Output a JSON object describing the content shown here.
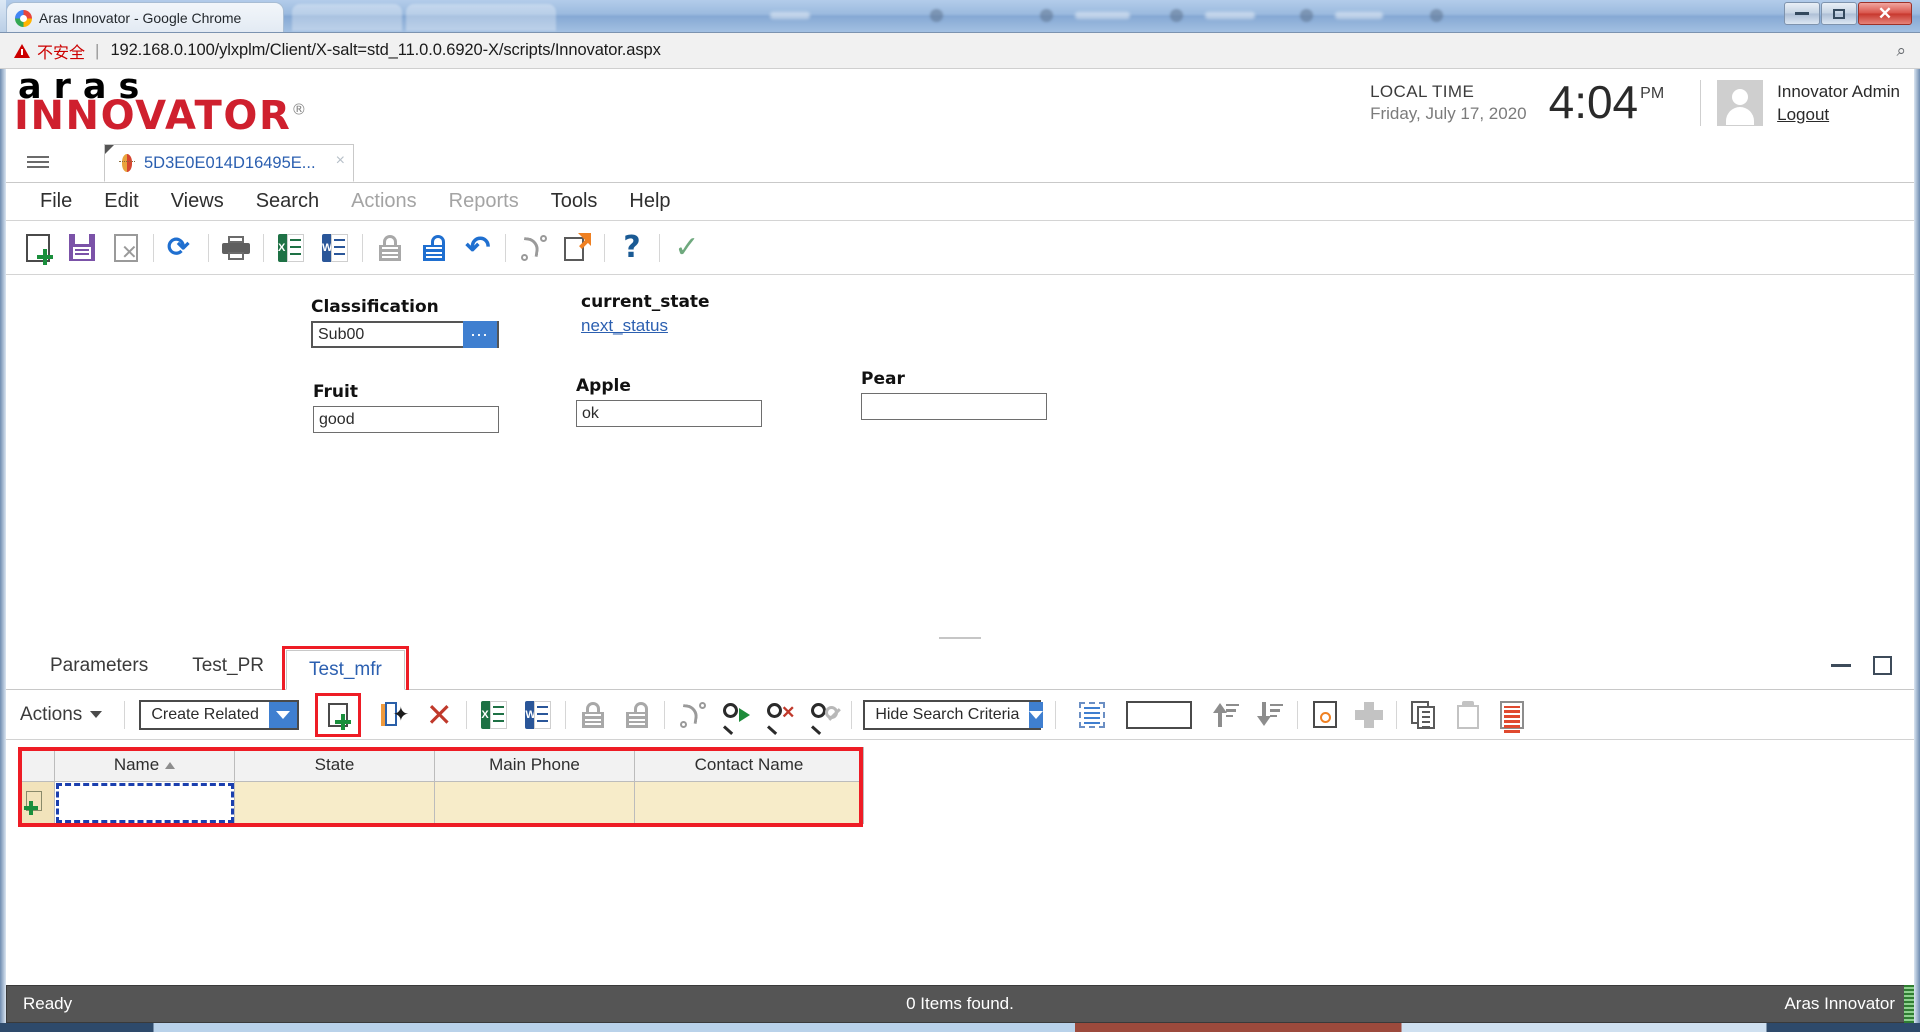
{
  "browser": {
    "tab_title": "Aras Innovator - Google Chrome",
    "favicon": "chrome-icon",
    "insecure_label": "不安全",
    "url_separator": "|",
    "url": "192.168.0.100/ylxplm/Client/X-salt=std_11.0.0.6920-X/scripts/Innovator.aspx",
    "zoom_icon": "magnifier-icon",
    "window_buttons": [
      "minimize",
      "maximize",
      "close"
    ]
  },
  "header": {
    "logo_top": "aras",
    "logo_bottom": "INNOVATOR",
    "logo_reg": "®",
    "local_time_label": "LOCAL TIME",
    "local_date": "Friday, July 17, 2020",
    "time": "4:04",
    "ampm": "PM",
    "avatar_icon": "user-avatar-icon",
    "user_name": "Innovator Admin",
    "logout_label": "Logout"
  },
  "tabstrip": {
    "menu_icon": "hamburger-icon",
    "item_tab_label": "5D3E0E014D16495E...",
    "item_tab_icon": "item-type-icon",
    "close_icon": "close-icon"
  },
  "menubar": {
    "items": [
      {
        "label": "File",
        "disabled": false
      },
      {
        "label": "Edit",
        "disabled": false
      },
      {
        "label": "Views",
        "disabled": false
      },
      {
        "label": "Search",
        "disabled": false
      },
      {
        "label": "Actions",
        "disabled": true
      },
      {
        "label": "Reports",
        "disabled": true
      },
      {
        "label": "Tools",
        "disabled": false
      },
      {
        "label": "Help",
        "disabled": false
      }
    ]
  },
  "toolbar": {
    "buttons": [
      {
        "name": "new-item-button",
        "icon": "new-page-icon"
      },
      {
        "name": "save-button",
        "icon": "save-floppy-icon"
      },
      {
        "name": "delete-button",
        "icon": "delete-page-icon"
      },
      {
        "name": "refresh-button",
        "icon": "refresh-icon"
      },
      {
        "name": "print-button",
        "icon": "print-icon"
      },
      {
        "name": "export-excel-button",
        "icon": "excel-icon"
      },
      {
        "name": "export-word-button",
        "icon": "word-icon"
      },
      {
        "name": "lock-button",
        "icon": "lock-icon"
      },
      {
        "name": "unlock-button",
        "icon": "unlock-icon"
      },
      {
        "name": "undo-button",
        "icon": "undo-icon"
      },
      {
        "name": "version-button",
        "icon": "version-icon"
      },
      {
        "name": "copy-item-button",
        "icon": "copy-arrow-icon"
      },
      {
        "name": "help-button",
        "icon": "question-mark-icon"
      },
      {
        "name": "done-button",
        "icon": "checkmark-icon"
      }
    ]
  },
  "form": {
    "classification": {
      "label": "Classification",
      "value": "Sub00",
      "picker_icon": "ellipsis-icon"
    },
    "current_state": {
      "label": "current_state",
      "link": "next_status"
    },
    "fruit": {
      "label": "Fruit",
      "value": "good"
    },
    "apple": {
      "label": "Apple",
      "value": "ok"
    },
    "pear": {
      "label": "Pear",
      "value": ""
    }
  },
  "relationship_tabs": {
    "tabs": [
      {
        "label": "Parameters",
        "active": false,
        "highlighted": false
      },
      {
        "label": "Test_PR",
        "active": false,
        "highlighted": false
      },
      {
        "label": "Test_mfr",
        "active": true,
        "highlighted": true
      }
    ],
    "panel_minimize_icon": "panel-minimize-icon",
    "panel_maximize_icon": "panel-maximize-icon"
  },
  "relationship_toolbar": {
    "actions_label": "Actions",
    "create_related_value": "Create Related",
    "search_criteria_value": "Hide Search Criteria",
    "page_size_value": "",
    "buttons": [
      {
        "name": "add-relationship-button",
        "icon": "new-page-plus-icon",
        "highlighted": true
      },
      {
        "name": "relate-existing-button",
        "icon": "relate-item-icon"
      },
      {
        "name": "remove-relationship-button",
        "icon": "red-x-icon"
      },
      {
        "name": "rel-export-excel-button",
        "icon": "excel-icon"
      },
      {
        "name": "rel-export-word-button",
        "icon": "word-icon"
      },
      {
        "name": "rel-lock-button",
        "icon": "lock-icon"
      },
      {
        "name": "rel-unlock-button",
        "icon": "unlock-icon"
      },
      {
        "name": "rel-version-button",
        "icon": "version-icon"
      },
      {
        "name": "run-search-button",
        "icon": "search-run-icon"
      },
      {
        "name": "clear-search-button",
        "icon": "search-clear-icon"
      },
      {
        "name": "disable-search-button",
        "icon": "search-disabled-icon"
      },
      {
        "name": "insert-row-button",
        "icon": "insert-row-icon"
      },
      {
        "name": "sort-ascending-button",
        "icon": "sort-asc-icon"
      },
      {
        "name": "sort-descending-button",
        "icon": "sort-desc-icon"
      },
      {
        "name": "search-page-button",
        "icon": "page-search-icon"
      },
      {
        "name": "expand-grid-button",
        "icon": "expand-icon"
      },
      {
        "name": "copy-button",
        "icon": "copy-icon"
      },
      {
        "name": "paste-button",
        "icon": "paste-icon"
      },
      {
        "name": "print-report-button",
        "icon": "red-lines-doc-icon"
      }
    ]
  },
  "grid": {
    "columns": [
      "Name",
      "State",
      "Main Phone",
      "Contact Name"
    ],
    "sort_column": "Name",
    "sort_direction": "asc",
    "rows": [
      {
        "Name": "",
        "State": "",
        "Main Phone": "",
        "Contact Name": "",
        "selected_cell": "Name"
      }
    ],
    "new_row_icon": "new-row-icon"
  },
  "statusbar": {
    "left": "Ready",
    "center": "0 Items found.",
    "right": "Aras Innovator"
  },
  "colors": {
    "accent_blue": "#3f7fd0",
    "brand_red": "#cf202e",
    "highlight_red": "#ee1c25",
    "grid_row": "#f7ecc9",
    "status_bg": "#555555"
  }
}
